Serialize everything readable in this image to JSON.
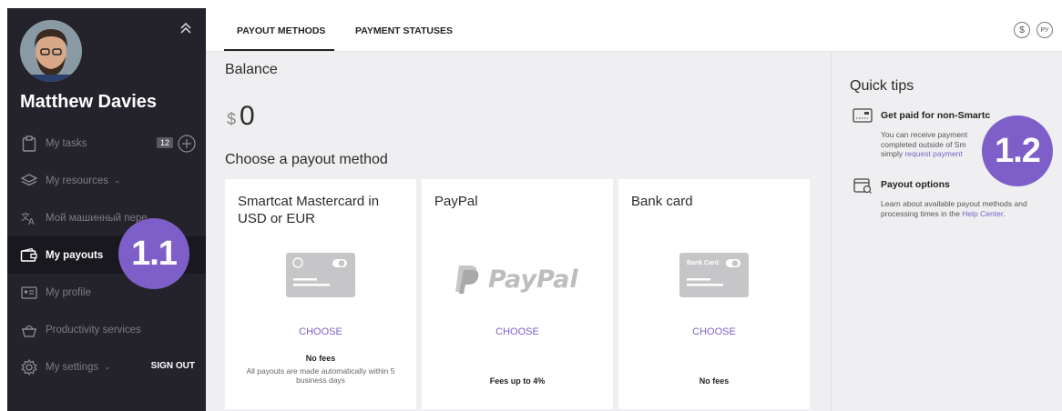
{
  "sidebar": {
    "user_name": "Matthew Davies",
    "items": [
      {
        "label": "My tasks",
        "icon": "clipboard-icon",
        "badge": "12"
      },
      {
        "label": "My resources",
        "icon": "layers-icon",
        "caret": "⌄"
      },
      {
        "label": "Мой машинный пере",
        "icon": "translate-icon"
      },
      {
        "label": "My payouts",
        "icon": "wallet-icon"
      },
      {
        "label": "My profile",
        "icon": "id-card-icon"
      },
      {
        "label": "Productivity services",
        "icon": "basket-icon"
      },
      {
        "label": "My settings",
        "icon": "gear-icon",
        "caret": "⌄"
      }
    ],
    "sign_out": "SIGN OUT"
  },
  "steps": {
    "left": "1.1",
    "right": "1.2"
  },
  "tabs": [
    {
      "label": "PAYOUT METHODS",
      "active": true
    },
    {
      "label": "PAYMENT STATUSES",
      "active": false
    }
  ],
  "header_icons": {
    "currency": "$",
    "language": "РУ"
  },
  "balance": {
    "title": "Balance",
    "currency": "$",
    "amount": "0"
  },
  "choose_title": "Choose a payout method",
  "cards": [
    {
      "title": "Smartcat Mastercard in USD or EUR",
      "button": "CHOOSE",
      "fee": "No fees",
      "note": "All payouts are made automatically within 5 business days"
    },
    {
      "title": "PayPal",
      "button": "CHOOSE",
      "fee": "Fees up to 4%",
      "logo_text": "PayPal"
    },
    {
      "title": "Bank card",
      "button": "CHOOSE",
      "fee": "No fees",
      "card_label": "Bank Card"
    }
  ],
  "tips": {
    "title": "Quick tips",
    "items": [
      {
        "head": "Get paid for non-Smartc",
        "body_1": "You can receive payment",
        "body_2": "completed outside of Sm",
        "body_3": "simply ",
        "link": "request payment"
      },
      {
        "head": "Payout options",
        "body": "Learn about available payout methods and processing times in the ",
        "link": "Help Center",
        "tail": "."
      }
    ]
  },
  "colors": {
    "accent": "#7b62c7",
    "step_bubble": "#7e5fc9",
    "sidebar_bg": "#24232b"
  }
}
